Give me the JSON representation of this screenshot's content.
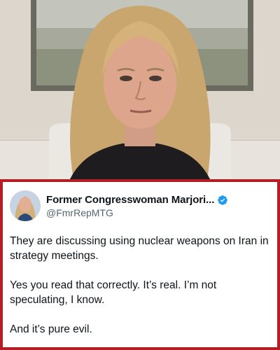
{
  "video": {
    "alt_scene": "woman speaking to camera in front of framed painting"
  },
  "tweet": {
    "author_name": "Former Congresswoman Marjori...",
    "author_handle": "@FmrRepMTG",
    "verified_icon": "verified-badge-icon",
    "paragraphs": [
      "They are discussing using nuclear weapons on Iran in strategy meetings.",
      "Yes you read that correctly.  It’s real.  I’m not speculating, I know.",
      "And it’s pure evil."
    ]
  },
  "colors": {
    "card_border": "#b51e24",
    "verified_blue": "#1d9bf0",
    "handle_gray": "#536471",
    "text": "#0f1419"
  }
}
